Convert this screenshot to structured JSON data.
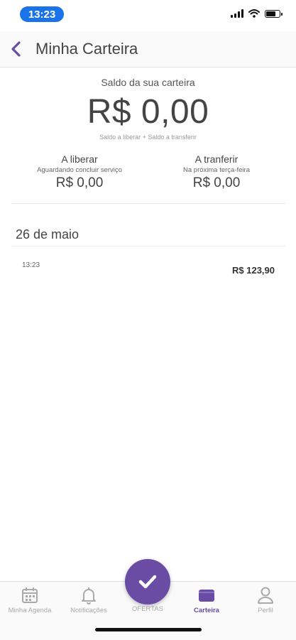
{
  "status_bar": {
    "time": "13:23"
  },
  "header": {
    "title": "Minha Carteira"
  },
  "balance": {
    "label": "Saldo da sua carteira",
    "value": "R$ 0,00",
    "caption": "Saldo a liberar + Saldo a transferir"
  },
  "pending": {
    "title": "A liberar",
    "caption": "Aguardando concluir serviço",
    "value": "R$ 0,00"
  },
  "transfer": {
    "title": "A tranferir",
    "caption": "Na próxima terça-feira",
    "value": "R$ 0,00"
  },
  "transactions": {
    "date": "26 de maio",
    "items": [
      {
        "time": "13:23",
        "amount": "R$ 123,90"
      }
    ]
  },
  "nav": {
    "items": [
      {
        "label": "Minha Agenda",
        "icon": "calendar-icon"
      },
      {
        "label": "Notificações",
        "icon": "bell-icon"
      },
      {
        "label": "OFERTAS",
        "icon": "check-icon"
      },
      {
        "label": "Carteira",
        "icon": "wallet-icon"
      },
      {
        "label": "Perfil",
        "icon": "user-icon"
      }
    ],
    "active_color": "#6a4ca5",
    "inactive_color": "#aaaaaa"
  }
}
